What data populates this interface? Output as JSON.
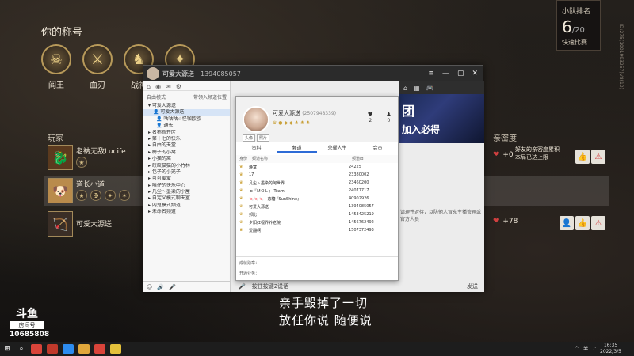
{
  "game": {
    "title_label": "你的称号",
    "badges": [
      {
        "name": "阎王",
        "icon": "demon-mask-icon",
        "glyph": "☠"
      },
      {
        "name": "血刃",
        "icon": "blade-icon",
        "glyph": "⚔"
      },
      {
        "name": "战神",
        "icon": "war-god-icon",
        "glyph": "♞"
      },
      {
        "name": "",
        "icon": "badge-icon",
        "glyph": "✦"
      }
    ],
    "rank": {
      "label": "小队排名",
      "value": "6",
      "total": "/20",
      "sub": "快速比赛"
    },
    "side_id": "ID:275(1001993257)V8(10)",
    "players_label": "玩家",
    "intimacy_label": "亲密度",
    "players": [
      {
        "name": "老衲无敌Lucife",
        "glyph": "🐉",
        "badges": [
          "★"
        ],
        "intimacy": "+0",
        "note": "好友的亲密度累积\n本局已达上限"
      },
      {
        "name": "道长小道",
        "glyph": "🐶",
        "badges": [
          "★",
          "✠",
          "✦",
          "✶"
        ],
        "intimacy": "",
        "note": ""
      },
      {
        "name": "可爱大源送",
        "glyph": "🏹",
        "badges": [],
        "intimacy": "+78",
        "note": ""
      }
    ],
    "lyrics": [
      "亲手毁掉了一切",
      "放任你说 随便说"
    ]
  },
  "douyu": {
    "logo": "斗鱼",
    "room_label": "房间号",
    "room_number": "10685808"
  },
  "taskbar": {
    "apps": [
      "#d9443a",
      "#c0392b",
      "#2d8cf0",
      "#e1a73b",
      "#d9443a",
      "#e4c13b"
    ],
    "clock_time": "16:35",
    "clock_date": "2022/3/5"
  },
  "yd": {
    "title_name": "可爱大源送",
    "title_id": "1394085057",
    "mode_label": "自由模式",
    "mode_right": "带领入频道位置",
    "tree": [
      {
        "label": "可爱大源送",
        "level": 0,
        "selected": false
      },
      {
        "label": "可爱大源送",
        "level": 1,
        "selected": true
      },
      {
        "label": "咕咕咕☆怪咖欧欧",
        "level": 1,
        "selected": false
      },
      {
        "label": "通长",
        "level": 1,
        "selected": false
      },
      {
        "label": "名称新开区",
        "level": 0,
        "selected": false
      },
      {
        "label": "第十七的快乐",
        "level": 0,
        "selected": false
      },
      {
        "label": "自由的天堂",
        "level": 0,
        "selected": false
      },
      {
        "label": "梅子的小窝",
        "level": 0,
        "selected": false
      },
      {
        "label": "小猫的窝",
        "level": 0,
        "selected": false
      },
      {
        "label": "皎皎猫猫的小竹林",
        "level": 0,
        "selected": false
      },
      {
        "label": "包子的小笼子",
        "level": 0,
        "selected": false
      },
      {
        "label": "可可爱爱",
        "level": 0,
        "selected": false
      },
      {
        "label": "嗑仔的快乐中心",
        "level": 0,
        "selected": false
      },
      {
        "label": "凡尘丶墨染的小屋",
        "level": 0,
        "selected": false
      },
      {
        "label": "自定义模式聊天室",
        "level": 0,
        "selected": false
      },
      {
        "label": "内鬼模式频道",
        "level": 0,
        "selected": false
      },
      {
        "label": "未命名频道",
        "level": 0,
        "selected": false
      }
    ],
    "bottom_label": "按住按键2说话",
    "profile": {
      "name": "可爱大源送",
      "uid": "(2507948339)",
      "btn1": "头像",
      "btn2": "照片",
      "stat1": "2",
      "stat2": "0",
      "tabs": [
        "资料",
        "频道",
        "荣耀人生",
        "会员"
      ],
      "active_tab": 1,
      "list_headers": [
        "身份",
        "频道名称",
        "频道id"
      ],
      "channels": [
        {
          "name": "焕寞",
          "id": "24225"
        },
        {
          "name": "17",
          "id": "23380002"
        },
        {
          "name": "凡尘丶墨染的阿世界",
          "id": "23460200"
        },
        {
          "name": "·ʚ『ＭＯＬ』 Team",
          "id": "24077717"
        },
        {
          "name": "🍬🍬🍬 · 恋糖·『SunShine』",
          "id": "40902926"
        },
        {
          "name": "可爱大源送",
          "id": "1394085057"
        },
        {
          "name": "邦比",
          "id": "1453425219"
        },
        {
          "name": "夕阳红视界养老院",
          "id": "1456762492"
        },
        {
          "name": "爱翻啊",
          "id": "1507372493"
        }
      ],
      "foot1": "成就勋章：",
      "foot2": "开通业务："
    },
    "banner_line1": "团",
    "banner_line2": "加入必得",
    "chat_text": "请理性对待，以防他人冒充主播管理或官方人员",
    "send_label": "发送"
  }
}
